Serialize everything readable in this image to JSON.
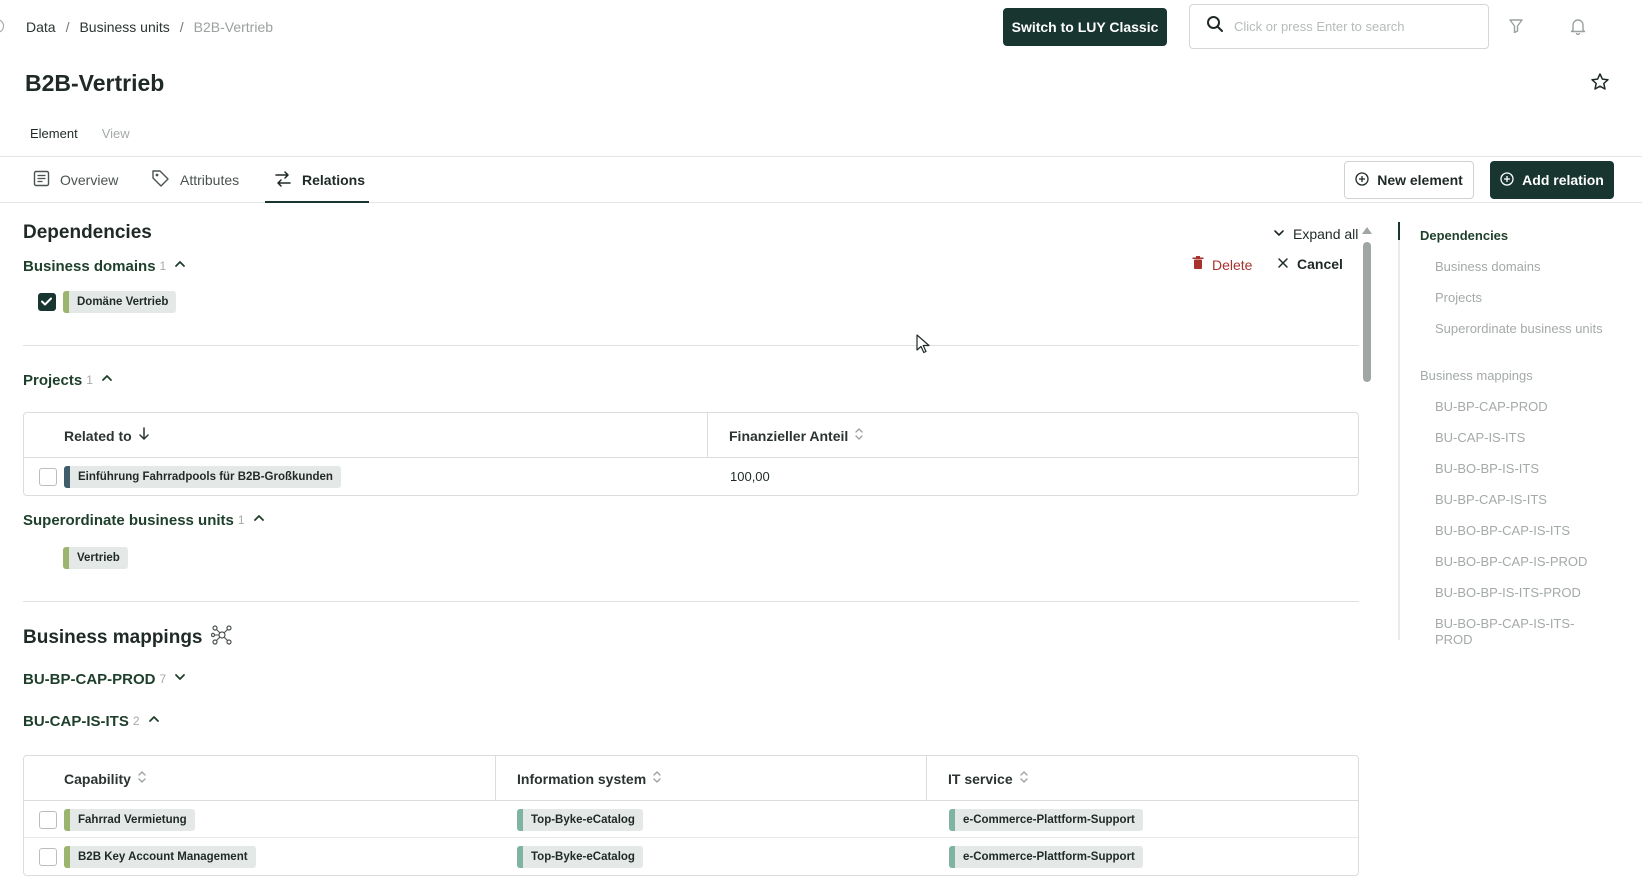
{
  "breadcrumb": [
    "Data",
    "Business units",
    "B2B-Vertrieb"
  ],
  "header": {
    "switch_label": "Switch to LUY Classic",
    "search_placeholder": "Click or press Enter to search"
  },
  "page_title": "B2B-Vertrieb",
  "subtabs": [
    "Element",
    "View"
  ],
  "tabs": [
    "Overview",
    "Attributes",
    "Relations"
  ],
  "actions": {
    "new_element": "New element",
    "add_relation": "Add relation"
  },
  "dependencies": {
    "title": "Dependencies",
    "expand_all": "Expand all",
    "delete": "Delete",
    "cancel": "Cancel",
    "business_domains": {
      "label": "Business domains",
      "count": "1",
      "items": [
        "Domäne Vertrieb"
      ]
    },
    "projects": {
      "label": "Projects",
      "count": "1",
      "columns": [
        "Related to",
        "Finanzieller Anteil"
      ],
      "rows": [
        {
          "related_to": "Einführung Fahrradpools für B2B-Großkunden",
          "anteil": "100,00"
        }
      ]
    },
    "superordinate": {
      "label": "Superordinate business units",
      "count": "1",
      "items": [
        "Vertrieb"
      ]
    }
  },
  "business_mappings": {
    "title": "Business mappings",
    "groups": [
      {
        "label": "BU-BP-CAP-PROD",
        "count": "7"
      },
      {
        "label": "BU-CAP-IS-ITS",
        "count": "2"
      }
    ],
    "table": {
      "columns": [
        "Capability",
        "Information system",
        "IT service"
      ],
      "rows": [
        {
          "capability": "Fahrrad Vermietung",
          "information_system": "Top-Byke-eCatalog",
          "it_service": "e-Commerce-Plattform-Support"
        },
        {
          "capability": "B2B Key Account Management",
          "information_system": "Top-Byke-eCatalog",
          "it_service": "e-Commerce-Plattform-Support"
        }
      ]
    }
  },
  "toc": [
    {
      "label": "Dependencies",
      "level": 1,
      "active": true
    },
    {
      "label": "Business domains",
      "level": 2
    },
    {
      "label": "Projects",
      "level": 2
    },
    {
      "label": "Superordinate business units",
      "level": 2
    },
    {
      "label": "Business mappings",
      "level": 1
    },
    {
      "label": "BU-BP-CAP-PROD",
      "level": 2
    },
    {
      "label": "BU-CAP-IS-ITS",
      "level": 2
    },
    {
      "label": "BU-BO-BP-IS-ITS",
      "level": 2
    },
    {
      "label": "BU-BP-CAP-IS-ITS",
      "level": 2
    },
    {
      "label": "BU-BO-BP-CAP-IS-ITS",
      "level": 2
    },
    {
      "label": "BU-BO-BP-CAP-IS-PROD",
      "level": 2
    },
    {
      "label": "BU-BO-BP-IS-ITS-PROD",
      "level": 2
    },
    {
      "label": "BU-BO-BP-CAP-IS-ITS-PROD",
      "level": 2
    }
  ],
  "colors": {
    "brand_dark": "#183530",
    "tag_domain": "#9bb56f",
    "tag_project": "#3f5d6b",
    "tag_capability": "#9bb56f",
    "tag_infosys": "#7fb5a0",
    "tag_itservice": "#7fb5a0",
    "delete_red": "#a8322d"
  },
  "icons": [
    "search-icon",
    "filter-icon",
    "bell-icon",
    "star-icon",
    "overview-icon",
    "tag-icon",
    "relations-icon",
    "plus-circle-icon",
    "chevron-down-icon",
    "chevron-up-icon",
    "trash-icon",
    "close-icon",
    "sort-icon",
    "network-icon",
    "check-icon"
  ]
}
